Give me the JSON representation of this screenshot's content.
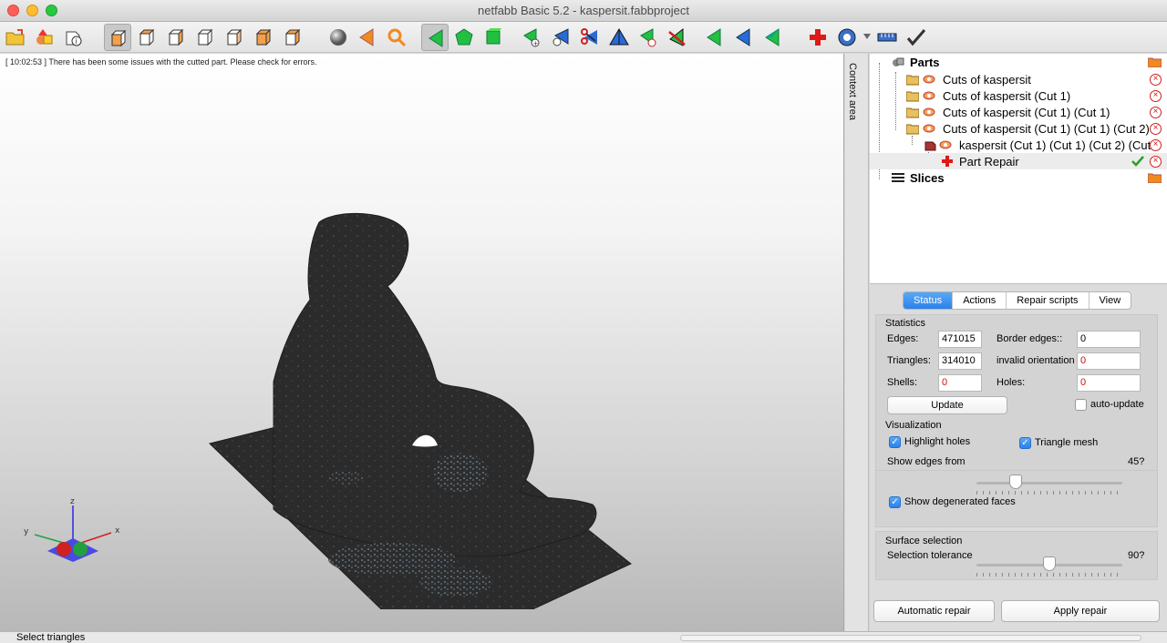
{
  "window": {
    "title": "netfabb Basic 5.2 - kaspersit.fabbproject",
    "traffic_lights": [
      "#ff5f57",
      "#febc2e",
      "#28c840"
    ]
  },
  "toolbar": {
    "icons": [
      "open-file-icon",
      "add-part-icon",
      "part-info-icon",
      "view-front-icon",
      "view-back-icon",
      "view-left-icon",
      "view-right-icon",
      "view-top-icon",
      "view-bottom-icon",
      "view-iso-icon",
      "shading-sphere-icon",
      "select-orange-icon",
      "zoom-magnifier-icon",
      "select-triangle-icon",
      "select-surface-icon",
      "select-shell-icon",
      "add-triangle-icon",
      "add-point-icon",
      "cut-scissors-icon",
      "flip-icon",
      "remove-triangle-icon",
      "remove-flag-icon",
      "select-green-icon",
      "select-blue-icon",
      "select-green-2-icon",
      "repair-cross-icon",
      "measure-icon",
      "ruler-icon",
      "apply-check-icon"
    ],
    "active_tool": "select-triangle-icon"
  },
  "viewport": {
    "log_message": "[ 10:02:53 ] There has been some issues with the cutted part. Please check for errors.",
    "axis_labels": {
      "x": "x",
      "y": "y",
      "z": "z"
    }
  },
  "statusbar": {
    "text": "Select triangles"
  },
  "context_tab": {
    "label": "Context area"
  },
  "tree": {
    "parts_label": "Parts",
    "items": [
      {
        "label": "Cuts of kaspersit"
      },
      {
        "label": "Cuts of kaspersit (Cut 1)"
      },
      {
        "label": "Cuts of kaspersit (Cut 1) (Cut 1)"
      },
      {
        "label": "Cuts of kaspersit (Cut 1) (Cut 1) (Cut 2)"
      },
      {
        "label": "kaspersit (Cut 1) (Cut 1) (Cut 2) (Cut"
      },
      {
        "label": "Part Repair"
      }
    ],
    "slices_label": "Slices"
  },
  "panel": {
    "tabs": [
      "Status",
      "Actions",
      "Repair scripts",
      "View"
    ],
    "active_tab": "Status",
    "statistics": {
      "title": "Statistics",
      "edges_label": "Edges:",
      "edges": "471015",
      "border_edges_label": "Border edges::",
      "border_edges": "0",
      "triangles_label": "Triangles:",
      "triangles": "314010",
      "invalid_orientation_label": "invalid orientation",
      "invalid_orientation": "0",
      "shells_label": "Shells:",
      "shells": "0",
      "holes_label": "Holes:",
      "holes": "0",
      "update_button": "Update",
      "auto_update_label": "auto-update",
      "auto_update_checked": false
    },
    "visualization": {
      "title": "Visualization",
      "highlight_holes_label": "Highlight holes",
      "highlight_holes": true,
      "triangle_mesh_label": "Triangle mesh",
      "triangle_mesh": true,
      "show_edges_label": "Show edges from",
      "show_edges_value": "45?",
      "show_edges_fraction": 0.27,
      "degenerated_label": "Show degenerated faces",
      "degenerated": true
    },
    "surface_selection": {
      "title": "Surface selection",
      "tolerance_label": "Selection tolerance",
      "tolerance_value": "90?",
      "tolerance_fraction": 0.5
    },
    "automatic_repair_button": "Automatic repair",
    "apply_repair_button": "Apply repair"
  }
}
